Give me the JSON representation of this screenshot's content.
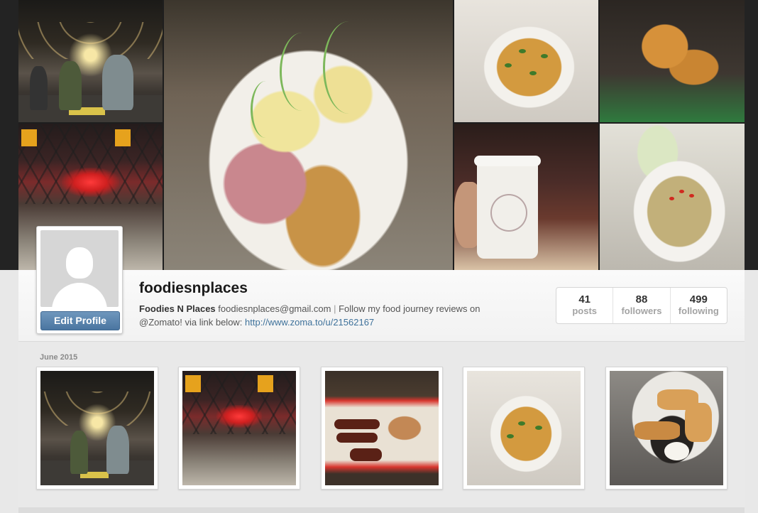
{
  "profile": {
    "username": "foodiesnplaces",
    "full_name": "Foodies N Places",
    "bio_email": "foodiesnplaces@gmail.com",
    "bio_separator": "|",
    "bio_text": "Follow my food journey reviews on @Zomato! via link below:",
    "bio_link": "http://www.zoma.to/u/21562167",
    "edit_button_label": "Edit Profile"
  },
  "stats": [
    {
      "value": "41",
      "label": "posts"
    },
    {
      "value": "88",
      "label": "followers"
    },
    {
      "value": "499",
      "label": "following"
    }
  ],
  "grid": {
    "month_label": "June 2015"
  },
  "colors": {
    "edit_button": "#4a75a0",
    "link": "#3f729b",
    "stat_label": "#a3a3a3"
  }
}
